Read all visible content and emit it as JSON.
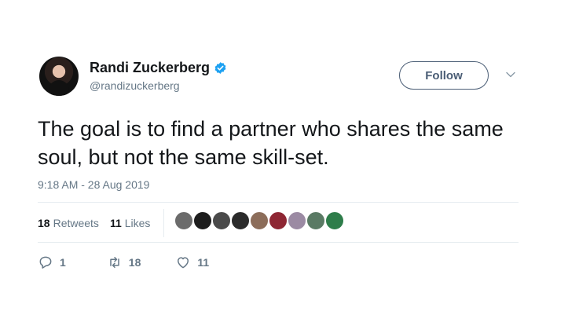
{
  "user": {
    "display_name": "Randi Zuckerberg",
    "handle": "@randizuckerberg",
    "verified": true
  },
  "header": {
    "follow_label": "Follow"
  },
  "tweet": {
    "text": "The goal is to find a partner who shares the same soul, but not the same skill-set.",
    "timestamp": "9:18 AM - 28 Aug 2019"
  },
  "stats": {
    "retweets_count": "18",
    "retweets_label": "Retweets",
    "likes_count": "11",
    "likes_label": "Likes"
  },
  "likers": [
    {
      "color": "#6b6b6b"
    },
    {
      "color": "#1d1d1d"
    },
    {
      "color": "#4a4a4a"
    },
    {
      "color": "#2b2b2b"
    },
    {
      "color": "#8c6d5a"
    },
    {
      "color": "#8e2633"
    },
    {
      "color": "#9b8aa3"
    },
    {
      "color": "#5a7a64"
    },
    {
      "color": "#2e7d4a"
    }
  ],
  "actions": {
    "reply_count": "1",
    "retweet_count": "18",
    "like_count": "11"
  },
  "colors": {
    "accent": "#1da1f2",
    "secondary_text": "#657786",
    "follow_border": "#4a5d75"
  }
}
